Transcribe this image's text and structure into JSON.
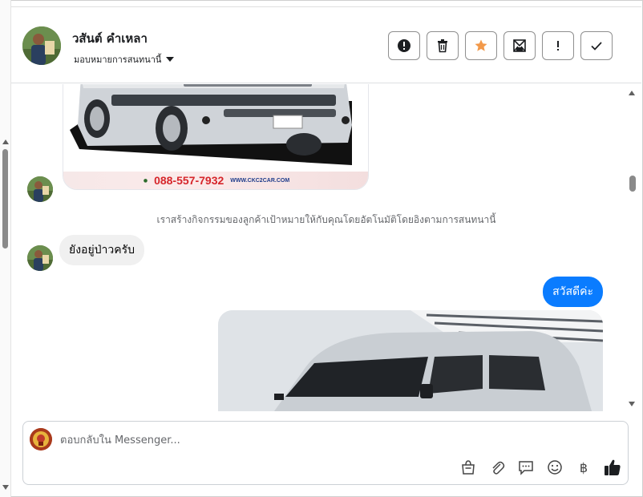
{
  "header": {
    "contact_name": "วสันต์ คำเหลา",
    "assign_label": "มอบหมายการสนทนานี้",
    "actions": [
      {
        "icon": "alert-circle-icon"
      },
      {
        "icon": "trash-icon"
      },
      {
        "icon": "star-icon",
        "color": "#f2994a"
      },
      {
        "icon": "mark-unread-icon"
      },
      {
        "icon": "exclamation-icon"
      },
      {
        "icon": "check-icon"
      }
    ]
  },
  "thread": {
    "ad_image": {
      "phone": "088-557-7932",
      "website": "WWW.CKC2CAR.COM"
    },
    "system_note": "เราสร้างกิจกรรมของลูกค้าเป้าหมายให้กับคุณโดยอัตโนมัติโดยอิงตามการสนทนานี้",
    "incoming_message": "ยังอยู่ป่าวครับ",
    "outgoing_message": "สวัสดีค่ะ"
  },
  "composer": {
    "placeholder": "ตอบกลับใน Messenger...",
    "tools": [
      "bag-icon",
      "paperclip-icon",
      "saved-reply-icon",
      "emoji-icon",
      "baht-icon",
      "thumbs-up-icon"
    ],
    "baht_glyph": "฿"
  },
  "colors": {
    "outgoing_bubble": "#0a7cff",
    "incoming_bubble": "#f0f0f0",
    "star": "#f2994a"
  }
}
